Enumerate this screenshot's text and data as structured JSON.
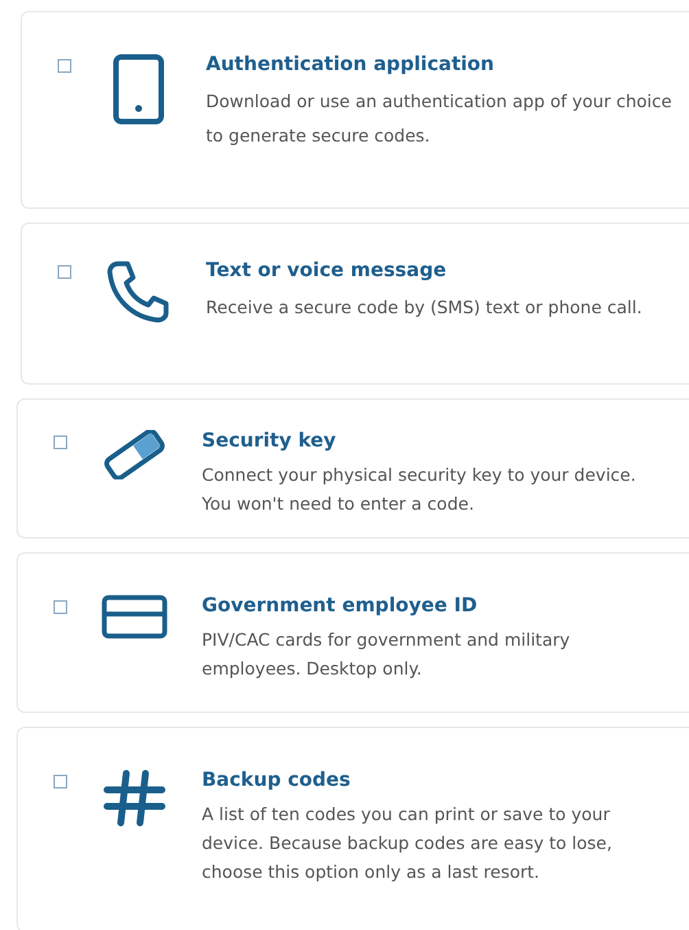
{
  "options": [
    {
      "kind": "tablet",
      "checked": false,
      "title": "Authentication application",
      "description": "Download or use an authentication app of your choice to generate secure codes."
    },
    {
      "kind": "phone",
      "checked": false,
      "title": "Text or voice message",
      "description": "Receive a secure code by (SMS) text or phone call."
    },
    {
      "kind": "key",
      "checked": false,
      "title": "Security key",
      "description": "Connect your physical security key to your device. You won't need to enter a code."
    },
    {
      "kind": "card",
      "checked": false,
      "title": "Government employee ID",
      "description": "PIV/CAC cards for government and military employees. Desktop only."
    },
    {
      "kind": "hash",
      "checked": false,
      "title": "Backup codes",
      "description": "A list of ten codes you can print or save to your device. Because backup codes are easy to lose, choose this option only as a last resort."
    }
  ]
}
